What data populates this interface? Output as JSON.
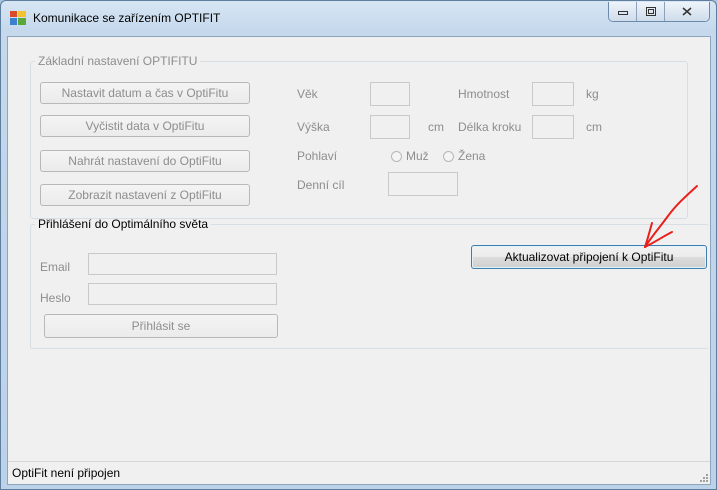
{
  "window": {
    "title": "Komunikace se zařízením OPTIFIT",
    "controls": {
      "minimize": "▭",
      "maximize": "▢",
      "close": "⨯"
    }
  },
  "basic_settings": {
    "legend": "Základní nastavení OPTIFITU",
    "buttons": {
      "set_datetime": "Nastavit datum a čas v OptiFitu",
      "clear_data": "Vyčistit data v OptiFitu",
      "upload_settings": "Nahrát nastavení do OptiFitu",
      "show_settings": "Zobrazit nastavení z OptiFitu"
    },
    "fields": {
      "age_label": "Věk",
      "weight_label": "Hmotnost",
      "weight_unit": "kg",
      "height_label": "Výška",
      "height_unit": "cm",
      "step_label": "Délka kroku",
      "step_unit": "cm",
      "gender_label": "Pohlaví",
      "male_label": "Muž",
      "female_label": "Žena",
      "daily_goal_label": "Denní cíl"
    }
  },
  "login": {
    "legend": "Přihlášení do Optimálního světa",
    "email_label": "Email",
    "password_label": "Heslo",
    "login_button": "Přihlásit se"
  },
  "update_button": "Aktualizovat připojení k OptiFitu",
  "status": {
    "text": "OptiFit není připojen"
  },
  "colors": {
    "annotation_arrow": "#e8201c",
    "focus_border": "#3c7fb1"
  }
}
